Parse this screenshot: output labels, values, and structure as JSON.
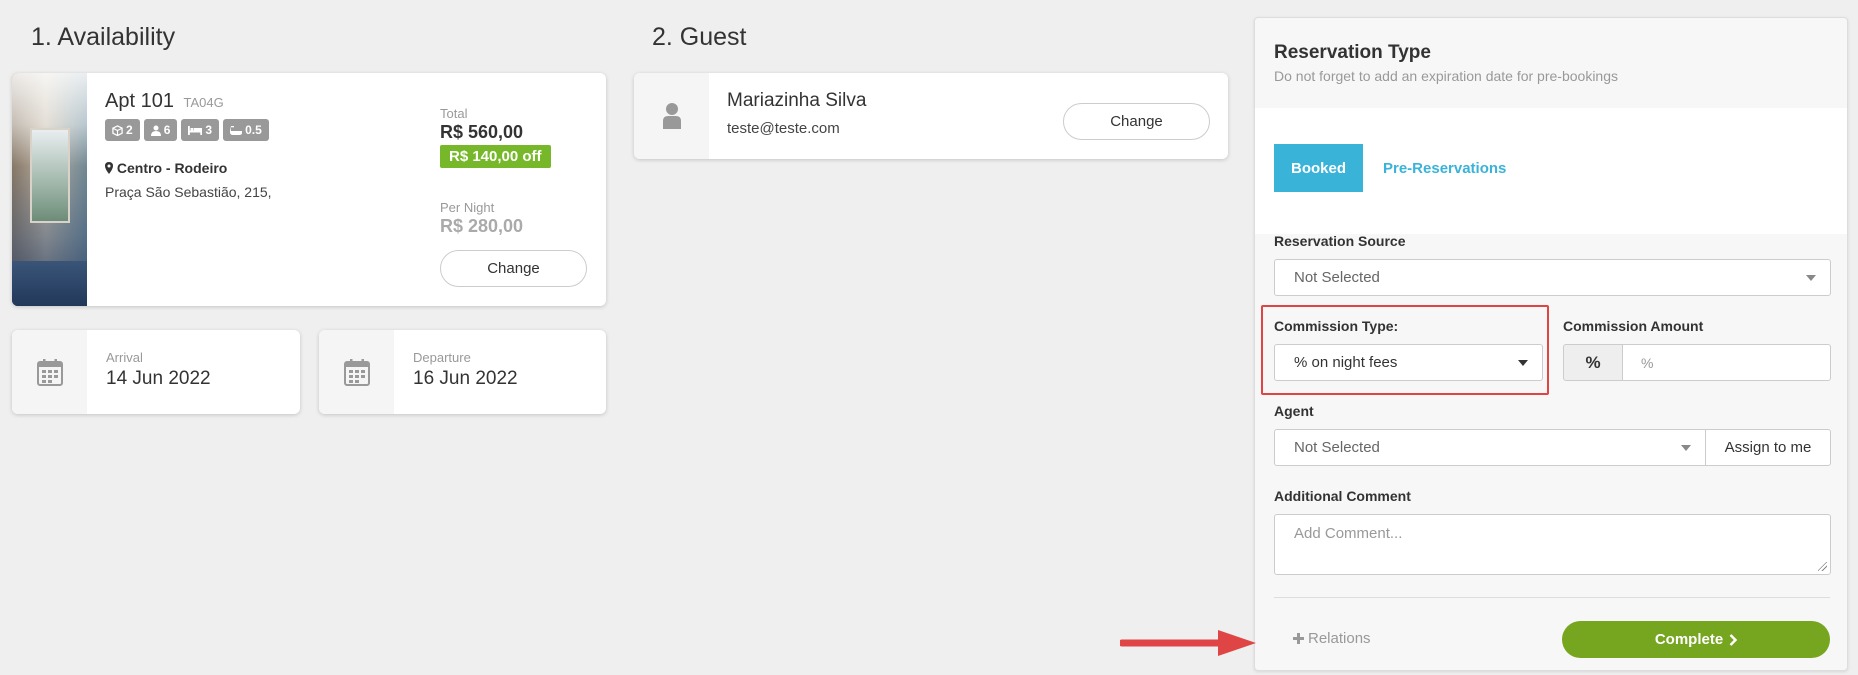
{
  "availability": {
    "title": "1. Availability",
    "apartment": {
      "name": "Apt 101",
      "code": "TA04G",
      "badges": [
        {
          "icon": "cube-icon",
          "value": "2"
        },
        {
          "icon": "user-icon",
          "value": "6"
        },
        {
          "icon": "bed-icon",
          "value": "3"
        },
        {
          "icon": "bath-icon",
          "value": "0.5"
        }
      ],
      "location": "Centro - Rodeiro",
      "address": "Praça São Sebastião, 215,",
      "total_label": "Total",
      "total_value": "R$ 560,00",
      "discount": "R$ 140,00 off",
      "per_night_label": "Per Night",
      "per_night_value": "R$ 280,00",
      "change_label": "Change"
    },
    "arrival": {
      "label": "Arrival",
      "value": "14 Jun 2022"
    },
    "departure": {
      "label": "Departure",
      "value": "16 Jun 2022"
    }
  },
  "guest": {
    "title": "2. Guest",
    "name": "Mariazinha Silva",
    "email": "teste@teste.com",
    "change_label": "Change"
  },
  "reservation": {
    "title": "Reservation Type",
    "subtitle": "Do not forget to add an expiration date for pre-bookings",
    "tabs": {
      "booked": "Booked",
      "pre": "Pre-Reservations"
    },
    "source": {
      "label": "Reservation Source",
      "value": "Not Selected"
    },
    "commission_type": {
      "label": "Commission Type:",
      "value": "% on night fees"
    },
    "commission_amount": {
      "label": "Commission Amount",
      "addon": "%",
      "placeholder": "%"
    },
    "agent": {
      "label": "Agent",
      "value": "Not Selected",
      "assign_label": "Assign to me"
    },
    "comment": {
      "label": "Additional Comment",
      "placeholder": "Add Comment..."
    },
    "relations_label": "Relations",
    "complete_label": "Complete"
  },
  "colors": {
    "accent_blue": "#3ab3d9",
    "success_green": "#76a51f",
    "discount_green": "#76b82a",
    "highlight_red": "#e04545"
  }
}
